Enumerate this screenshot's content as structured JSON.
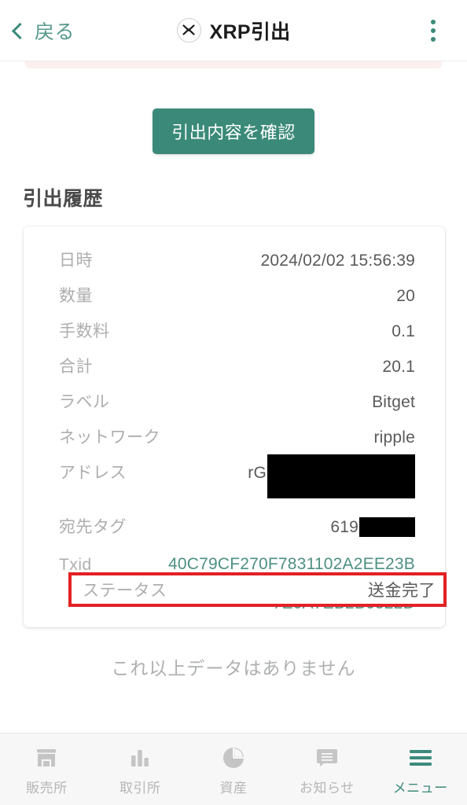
{
  "header": {
    "back_label": "戻る",
    "title": "XRP引出",
    "coin_icon": "xrp-circle-icon",
    "menu_icon": "kebab-menu-icon",
    "accent_color": "#3d8a7b"
  },
  "banner": {
    "background_color": "#fbf0ee"
  },
  "actions": {
    "confirm_label": "引出内容を確認",
    "confirm_color": "#3b8a79"
  },
  "history": {
    "section_title": "引出履歴",
    "rows": [
      {
        "label": "日時",
        "value": "2024/02/02 15:56:39"
      },
      {
        "label": "数量",
        "value": "20"
      },
      {
        "label": "手数料",
        "value": "0.1"
      },
      {
        "label": "合計",
        "value": "20.1"
      },
      {
        "label": "ラベル",
        "value": "Bitget"
      },
      {
        "label": "ネットワーク",
        "value": "ripple"
      }
    ],
    "address": {
      "label": "アドレス",
      "value_prefix": "rG",
      "redacted": true
    },
    "destination_tag": {
      "label": "宛先タグ",
      "value_prefix": "619",
      "redacted": true
    },
    "txid": {
      "label": "Txid",
      "value": "40C79CF270F7831102A2EE23B72634A2E62A5C75A9856E22217E0A7EB2B0522D",
      "color": "#4d9082"
    },
    "status": {
      "label": "ステータス",
      "value": "送金完了",
      "highlight_color": "#e32024"
    },
    "no_more_data": "これ以上データはありません"
  },
  "bottom_nav": {
    "items": [
      {
        "label": "販売所",
        "icon": "storefront-icon",
        "active": false
      },
      {
        "label": "取引所",
        "icon": "bar-chart-icon",
        "active": false
      },
      {
        "label": "資産",
        "icon": "pie-chart-icon",
        "active": false
      },
      {
        "label": "お知らせ",
        "icon": "message-icon",
        "active": false
      },
      {
        "label": "メニュー",
        "icon": "hamburger-icon",
        "active": true
      }
    ]
  }
}
